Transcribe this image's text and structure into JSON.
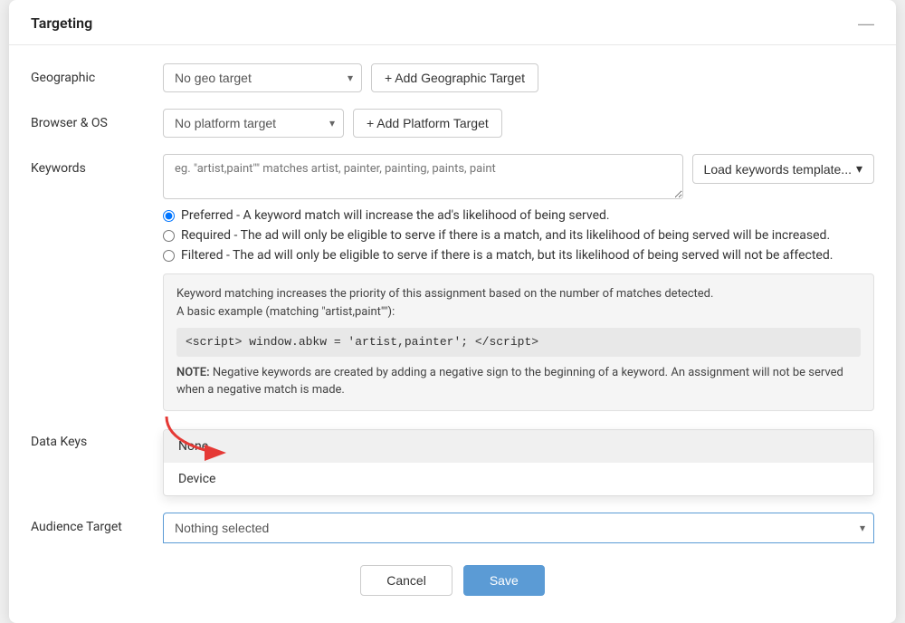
{
  "panel": {
    "title": "Targeting",
    "minimize_icon": "—"
  },
  "geographic": {
    "label": "Geographic",
    "select_value": "No geo target",
    "select_placeholder": "No geo target",
    "add_button": "+ Add Geographic Target"
  },
  "browser_os": {
    "label": "Browser & OS",
    "select_value": "No platform target",
    "select_placeholder": "No platform target",
    "add_button": "+ Add Platform Target"
  },
  "keywords": {
    "label": "Keywords",
    "textarea_placeholder": "eg. \"artist,paint\"\" matches artist, painter, painting, paints, paint",
    "load_template_button": "Load keywords template...",
    "radio_options": [
      {
        "id": "preferred",
        "label": "Preferred - A keyword match will increase the ad's likelihood of being served.",
        "checked": true
      },
      {
        "id": "required",
        "label": "Required - The ad will only be eligible to serve if there is a match, and its likelihood of being served will be increased.",
        "checked": false
      },
      {
        "id": "filtered",
        "label": "Filtered - The ad will only be eligible to serve if there is a match, but its likelihood of being served will not be affected.",
        "checked": false
      }
    ],
    "info_box": {
      "text1": "Keyword matching increases the priority of this assignment based on the number of matches detected.",
      "text2": "A basic example (matching \"artist,paint\"\"):",
      "code": "<script> window.abkw = 'artist,painter'; </script>",
      "note_label": "NOTE:",
      "note_text": " Negative keywords are created by adding a negative sign to the beginning of a keyword. An assignment will not be served when a negative match is made."
    }
  },
  "data_keys": {
    "label": "Data Keys",
    "dropdown": {
      "items": [
        {
          "value": "none",
          "label": "None"
        },
        {
          "value": "device",
          "label": "Device"
        }
      ]
    }
  },
  "audience_target": {
    "label": "Audience Target",
    "select_placeholder": "Nothing selected"
  },
  "footer": {
    "cancel_label": "Cancel",
    "save_label": "Save"
  }
}
